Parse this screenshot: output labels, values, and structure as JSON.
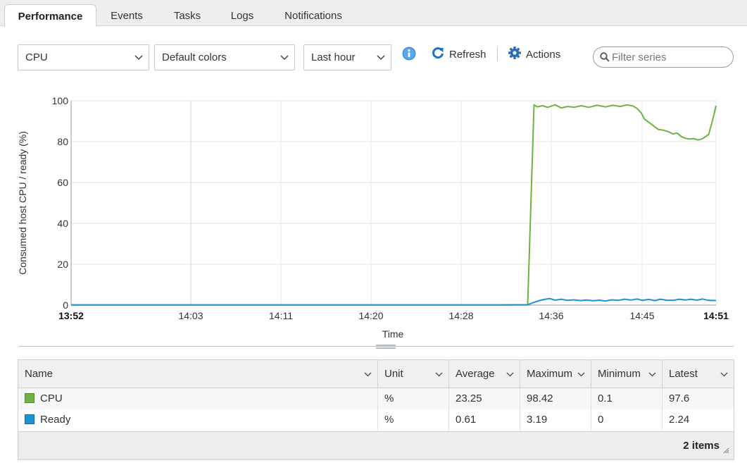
{
  "tabs": [
    {
      "label": "Performance",
      "active": true
    },
    {
      "label": "Events",
      "active": false
    },
    {
      "label": "Tasks",
      "active": false
    },
    {
      "label": "Logs",
      "active": false
    },
    {
      "label": "Notifications",
      "active": false
    }
  ],
  "toolbar": {
    "metric_select": "CPU",
    "color_select": "Default colors",
    "timespan_select": "Last hour",
    "refresh_label": "Refresh",
    "actions_label": "Actions",
    "filter_placeholder": "Filter series",
    "info_icon": "info-icon",
    "refresh_icon": "refresh-icon",
    "actions_icon": "gear-icon"
  },
  "chart_data": {
    "type": "line",
    "ylabel": "Consumed host CPU / ready (%)",
    "xlabel": "Time",
    "ylim": [
      0,
      100
    ],
    "yticks": [
      0,
      20,
      40,
      60,
      80,
      100
    ],
    "xticks": [
      "13:52",
      "14:03",
      "14:11",
      "14:20",
      "14:28",
      "14:36",
      "14:45",
      "14:51"
    ],
    "xrange_minutes": [
      0,
      59
    ],
    "grid": true,
    "series": [
      {
        "name": "CPU",
        "color": "#6db33f",
        "points": [
          [
            0,
            0.1
          ],
          [
            10,
            0.1
          ],
          [
            20,
            0.1
          ],
          [
            30,
            0.1
          ],
          [
            40,
            0.1
          ],
          [
            43.4,
            0.2
          ],
          [
            44.0,
            98.0
          ],
          [
            44.3,
            97.0
          ],
          [
            44.8,
            97.6
          ],
          [
            45.3,
            96.8
          ],
          [
            46.0,
            98.0
          ],
          [
            46.6,
            96.5
          ],
          [
            47.2,
            97.2
          ],
          [
            47.8,
            96.8
          ],
          [
            48.5,
            97.6
          ],
          [
            49.2,
            96.8
          ],
          [
            50.0,
            97.8
          ],
          [
            50.8,
            97.0
          ],
          [
            51.5,
            97.8
          ],
          [
            52.2,
            97.2
          ],
          [
            52.8,
            98.0
          ],
          [
            53.4,
            97.5
          ],
          [
            53.8,
            96.2
          ],
          [
            54.2,
            94.0
          ],
          [
            54.5,
            91.0
          ],
          [
            54.9,
            89.5
          ],
          [
            55.3,
            88.0
          ],
          [
            55.8,
            86.0
          ],
          [
            56.3,
            85.6
          ],
          [
            56.8,
            84.8
          ],
          [
            57.2,
            83.8
          ],
          [
            57.6,
            84.2
          ],
          [
            58.0,
            82.5
          ],
          [
            58.4,
            81.6
          ],
          [
            58.8,
            81.3
          ],
          [
            59.2,
            81.5
          ],
          [
            59.6,
            80.8
          ],
          [
            60.0,
            81.4
          ],
          [
            60.6,
            83.5
          ],
          [
            61.0,
            91.0
          ],
          [
            61.3,
            97.6
          ]
        ]
      },
      {
        "name": "Ready",
        "color": "#1a93d1",
        "points": [
          [
            0,
            0.1
          ],
          [
            10,
            0.1
          ],
          [
            20,
            0.1
          ],
          [
            30,
            0.1
          ],
          [
            40,
            0.1
          ],
          [
            43.4,
            0.1
          ],
          [
            43.9,
            1.2
          ],
          [
            44.5,
            2.2
          ],
          [
            45.0,
            2.8
          ],
          [
            45.5,
            3.2
          ],
          [
            46.0,
            2.4
          ],
          [
            46.6,
            2.9
          ],
          [
            47.2,
            2.3
          ],
          [
            47.8,
            2.6
          ],
          [
            48.4,
            2.2
          ],
          [
            49.0,
            2.5
          ],
          [
            49.6,
            2.1
          ],
          [
            50.2,
            2.4
          ],
          [
            50.8,
            2.0
          ],
          [
            51.4,
            2.6
          ],
          [
            52.0,
            2.3
          ],
          [
            52.6,
            2.9
          ],
          [
            53.2,
            2.5
          ],
          [
            53.8,
            3.0
          ],
          [
            54.3,
            2.3
          ],
          [
            54.9,
            2.8
          ],
          [
            55.5,
            2.2
          ],
          [
            56.0,
            2.9
          ],
          [
            56.6,
            2.4
          ],
          [
            57.2,
            2.3
          ],
          [
            57.8,
            2.9
          ],
          [
            58.4,
            2.5
          ],
          [
            58.9,
            2.9
          ],
          [
            59.5,
            2.4
          ],
          [
            60.0,
            3.0
          ],
          [
            60.6,
            2.3
          ],
          [
            61.3,
            2.24
          ]
        ]
      }
    ]
  },
  "table": {
    "columns": [
      "Name",
      "Unit",
      "Average",
      "Maximum",
      "Minimum",
      "Latest"
    ],
    "rows": [
      {
        "name": "CPU",
        "color": "#6db33f",
        "unit": "%",
        "average": "23.25",
        "maximum": "98.42",
        "minimum": "0.1",
        "latest": "97.6"
      },
      {
        "name": "Ready",
        "color": "#1a93d1",
        "unit": "%",
        "average": "0.61",
        "maximum": "3.19",
        "minimum": "0",
        "latest": "2.24"
      }
    ],
    "footer_count": "2 items"
  }
}
